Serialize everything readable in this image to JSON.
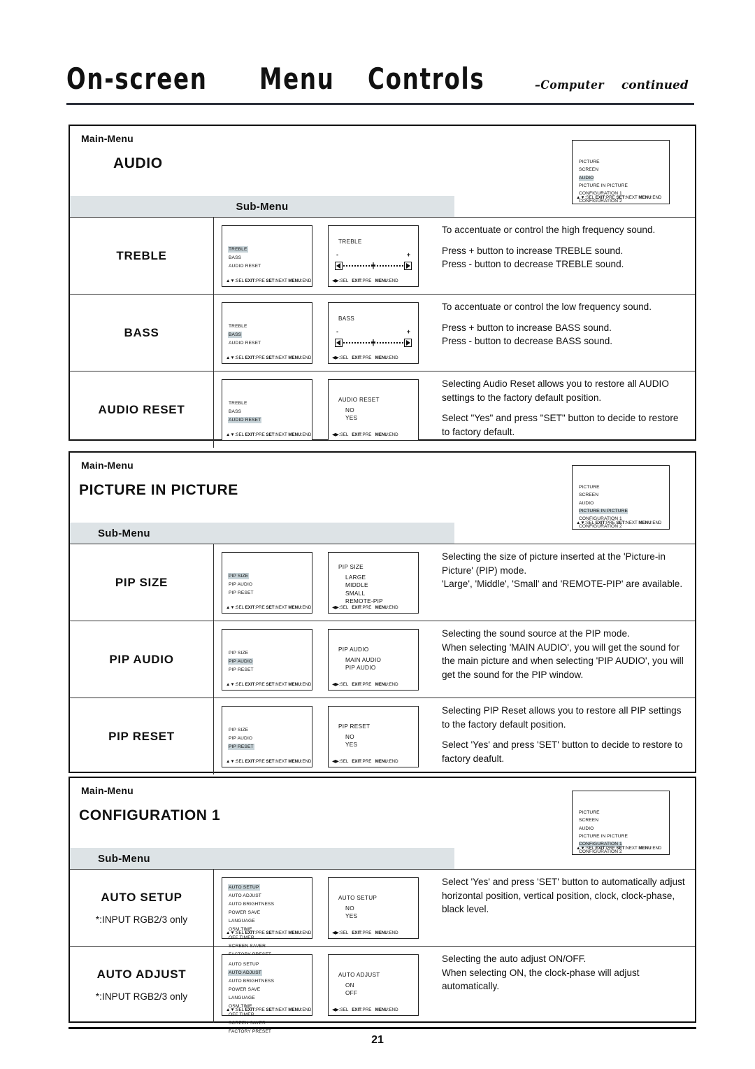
{
  "header": {
    "title_words": [
      "On-screen",
      "Menu",
      "Controls"
    ],
    "subtitle": "–Computer",
    "subtitle2": "continued"
  },
  "labels": {
    "main_menu": "Main-Menu",
    "sub_menu": "Sub-Menu",
    "osd_foot_nav": "▲▼:SEL EXIT:PRE SET:NEXT MENU:END",
    "osd_foot_lr": "◀▶:SEL    EXIT:PRE    MENU:END",
    "input_note": "*:INPUT RGB2/3 only"
  },
  "main_menu_items": [
    "PICTURE",
    "SCREEN",
    "AUDIO",
    "PICTURE IN PICTURE",
    "CONFIGURATION 1",
    "CONFIGURATION 2"
  ],
  "sections": [
    {
      "id": "audio",
      "title": "AUDIO",
      "highlighted_main_item": "AUDIO",
      "submenu_align": "center",
      "sub_items": [
        "TREBLE",
        "BASS",
        "AUDIO RESET"
      ],
      "rows": [
        {
          "label": "TREBLE",
          "note": "",
          "osd_highlight": "TREBLE",
          "value_title": "TREBLE",
          "value_type": "slider",
          "value_options": [],
          "desc_top": "To accentuate or control the high frequency sound.",
          "desc_bottom": "Press + button to increase TREBLE sound.\nPress - button to decrease TREBLE sound."
        },
        {
          "label": "BASS",
          "note": "",
          "osd_highlight": "BASS",
          "value_title": "BASS",
          "value_type": "slider",
          "value_options": [],
          "desc_top": "To accentuate or control the low frequency sound.",
          "desc_bottom": "Press + button to increase BASS sound.\nPress - button to decrease BASS sound."
        },
        {
          "label": "AUDIO RESET",
          "note": "",
          "osd_highlight": "AUDIO RESET",
          "value_title": "AUDIO RESET",
          "value_type": "list",
          "value_options": [
            "NO",
            "YES"
          ],
          "desc_top": "Selecting Audio Reset allows you to restore all AUDIO settings to the factory default position.",
          "desc_bottom": "Select \"Yes\" and press \"SET\" button to decide to restore to factory default."
        }
      ]
    },
    {
      "id": "pip",
      "title": "PICTURE IN PICTURE",
      "highlighted_main_item": "PICTURE IN PICTURE",
      "submenu_align": "left",
      "sub_items": [
        "PIP SIZE",
        "PIP AUDIO",
        "PIP RESET"
      ],
      "rows": [
        {
          "label": "PIP SIZE",
          "note": "",
          "osd_highlight": "PIP SIZE",
          "value_title": "PIP SIZE",
          "value_type": "list",
          "value_options": [
            "LARGE",
            "MIDDLE",
            "SMALL",
            "REMOTE-PIP"
          ],
          "desc_top": "Selecting the size of picture inserted at the 'Picture-in Picture' (PIP) mode.\n'Large', 'Middle', 'Small' and 'REMOTE-PIP' are available.",
          "desc_bottom": ""
        },
        {
          "label": "PIP AUDIO",
          "note": "",
          "osd_highlight": "PIP AUDIO",
          "value_title": "PIP AUDIO",
          "value_type": "list",
          "value_options": [
            "MAIN AUDIO",
            "PIP AUDIO"
          ],
          "desc_top": "Selecting the sound source at the PIP mode.\nWhen selecting 'MAIN AUDIO', you will get the sound for the main picture and when selecting 'PIP AUDIO', you will get the sound for the PIP window.",
          "desc_bottom": ""
        },
        {
          "label": "PIP RESET",
          "note": "",
          "osd_highlight": "PIP RESET",
          "value_title": "PIP RESET",
          "value_type": "list",
          "value_options": [
            "NO",
            "YES"
          ],
          "desc_top": "Selecting PIP Reset allows you to restore all PIP settings to the factory default position.",
          "desc_bottom": "Select 'Yes' and press 'SET' button to decide to restore to factory deafult."
        }
      ]
    },
    {
      "id": "cfg",
      "title": "CONFIGURATION 1",
      "highlighted_main_item": "CONFIGURATION 1",
      "submenu_align": "left",
      "sub_items": [
        "AUTO SETUP",
        "AUTO ADJUST",
        "AUTO BRIGHTNESS",
        "POWER SAVE",
        "LANGUAGE",
        "OSM TIME",
        "OFF TIMER",
        "SCREEN SAVER",
        "FACTORY PRESET"
      ],
      "rows": [
        {
          "label": "AUTO SETUP",
          "note": "*:INPUT RGB2/3 only",
          "osd_highlight": "AUTO SETUP",
          "value_title": "AUTO SETUP",
          "value_type": "list",
          "value_options": [
            "NO",
            "YES"
          ],
          "desc_top": "Select 'Yes' and press 'SET' button to automatically adjust horizontal position, vertical position, clock, clock-phase, black level.",
          "desc_bottom": ""
        },
        {
          "label": "AUTO ADJUST",
          "note": "*:INPUT RGB2/3 only",
          "osd_highlight": "AUTO ADJUST",
          "value_title": "AUTO ADJUST",
          "value_type": "list",
          "value_options": [
            "ON",
            "OFF"
          ],
          "desc_top": "Selecting the auto adjust ON/OFF.\nWhen selecting ON, the clock-phase will adjust automatically.",
          "desc_bottom": ""
        }
      ]
    }
  ],
  "footer": {
    "page_number": "21"
  },
  "colors": {
    "highlight": "#c7d3d8",
    "submenu_bar": "#dde3e6",
    "rule": "#2b2f3a"
  }
}
